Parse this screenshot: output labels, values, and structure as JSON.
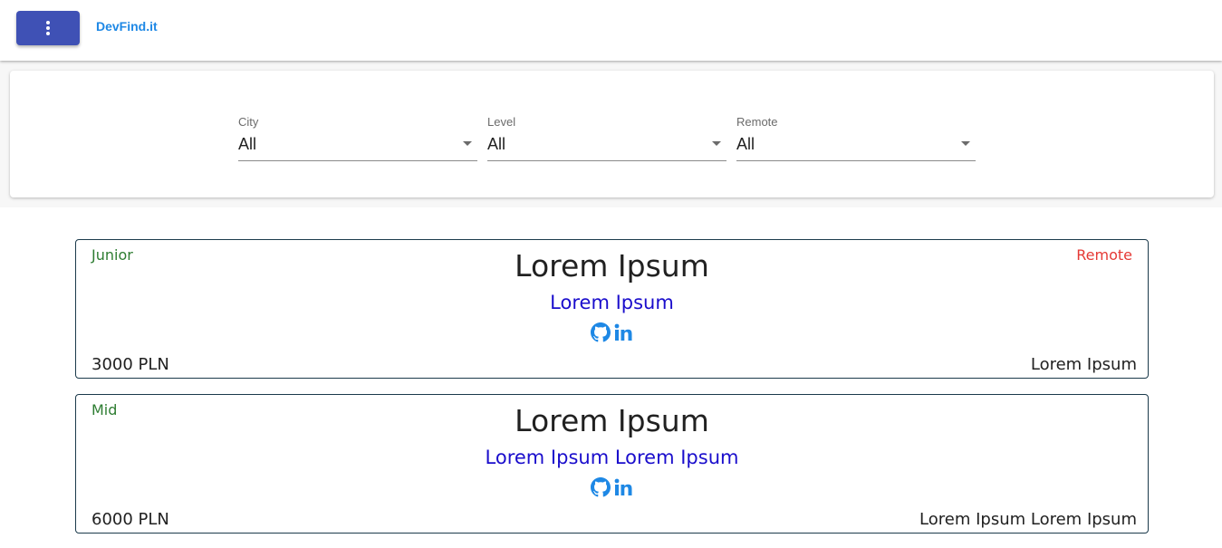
{
  "app": {
    "brand": "DevFind.it",
    "menu_icon": "dots-vertical-icon",
    "accent_color": "#3f51b5",
    "brand_color": "#1e88e5"
  },
  "filters": {
    "city": {
      "label": "City",
      "value": "All"
    },
    "level": {
      "label": "Level",
      "value": "All"
    },
    "remote": {
      "label": "Remote",
      "value": "All"
    }
  },
  "developers": [
    {
      "level": "Junior",
      "remote": "Remote",
      "name": "Lorem Ipsum",
      "title": "Lorem Ipsum",
      "salary": "3000 PLN",
      "tech": "Lorem Ipsum",
      "icons": [
        "github-icon",
        "linkedin-icon"
      ]
    },
    {
      "level": "Mid",
      "remote": "",
      "name": "Lorem Ipsum",
      "title": "Lorem Ipsum Lorem Ipsum",
      "salary": "6000 PLN",
      "tech": "Lorem Ipsum Lorem Ipsum",
      "icons": [
        "github-icon",
        "linkedin-icon"
      ]
    }
  ],
  "colors": {
    "level": "#2e7d32",
    "remote": "#e53935",
    "title": "#1a0dcc",
    "icons": "#1e88e5"
  }
}
